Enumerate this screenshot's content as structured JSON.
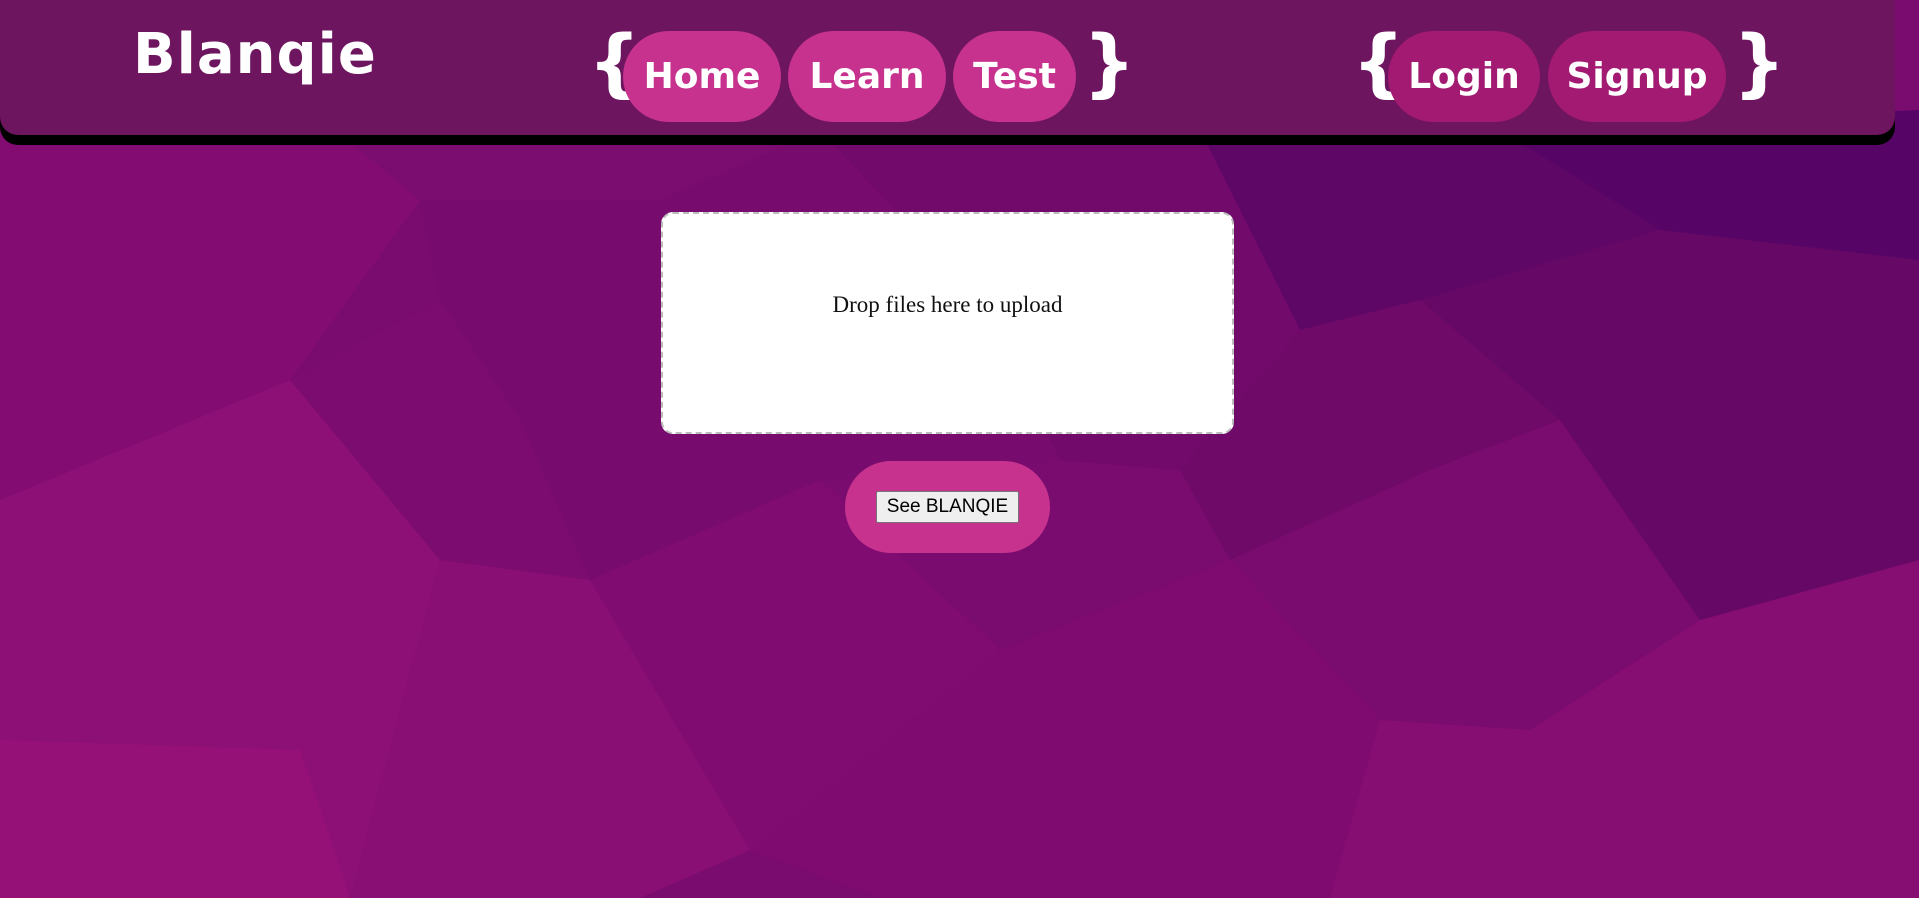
{
  "brand": {
    "name": "Blanqie"
  },
  "nav": {
    "open_brace": "{",
    "close_brace": "}",
    "items": [
      {
        "label": "Home"
      },
      {
        "label": "Learn"
      },
      {
        "label": "Test"
      }
    ]
  },
  "auth": {
    "open_brace": "{",
    "close_brace": "}",
    "login_label": "Login",
    "signup_label": "Signup"
  },
  "upload": {
    "dropzone_text": "Drop files here to upload"
  },
  "actions": {
    "see_label": "See BLANQIE"
  },
  "colors": {
    "header_bg": "#6d155f",
    "nav_pill": "#c6328e",
    "auth_pill": "#a31a72",
    "background": "#7a0b6f"
  }
}
